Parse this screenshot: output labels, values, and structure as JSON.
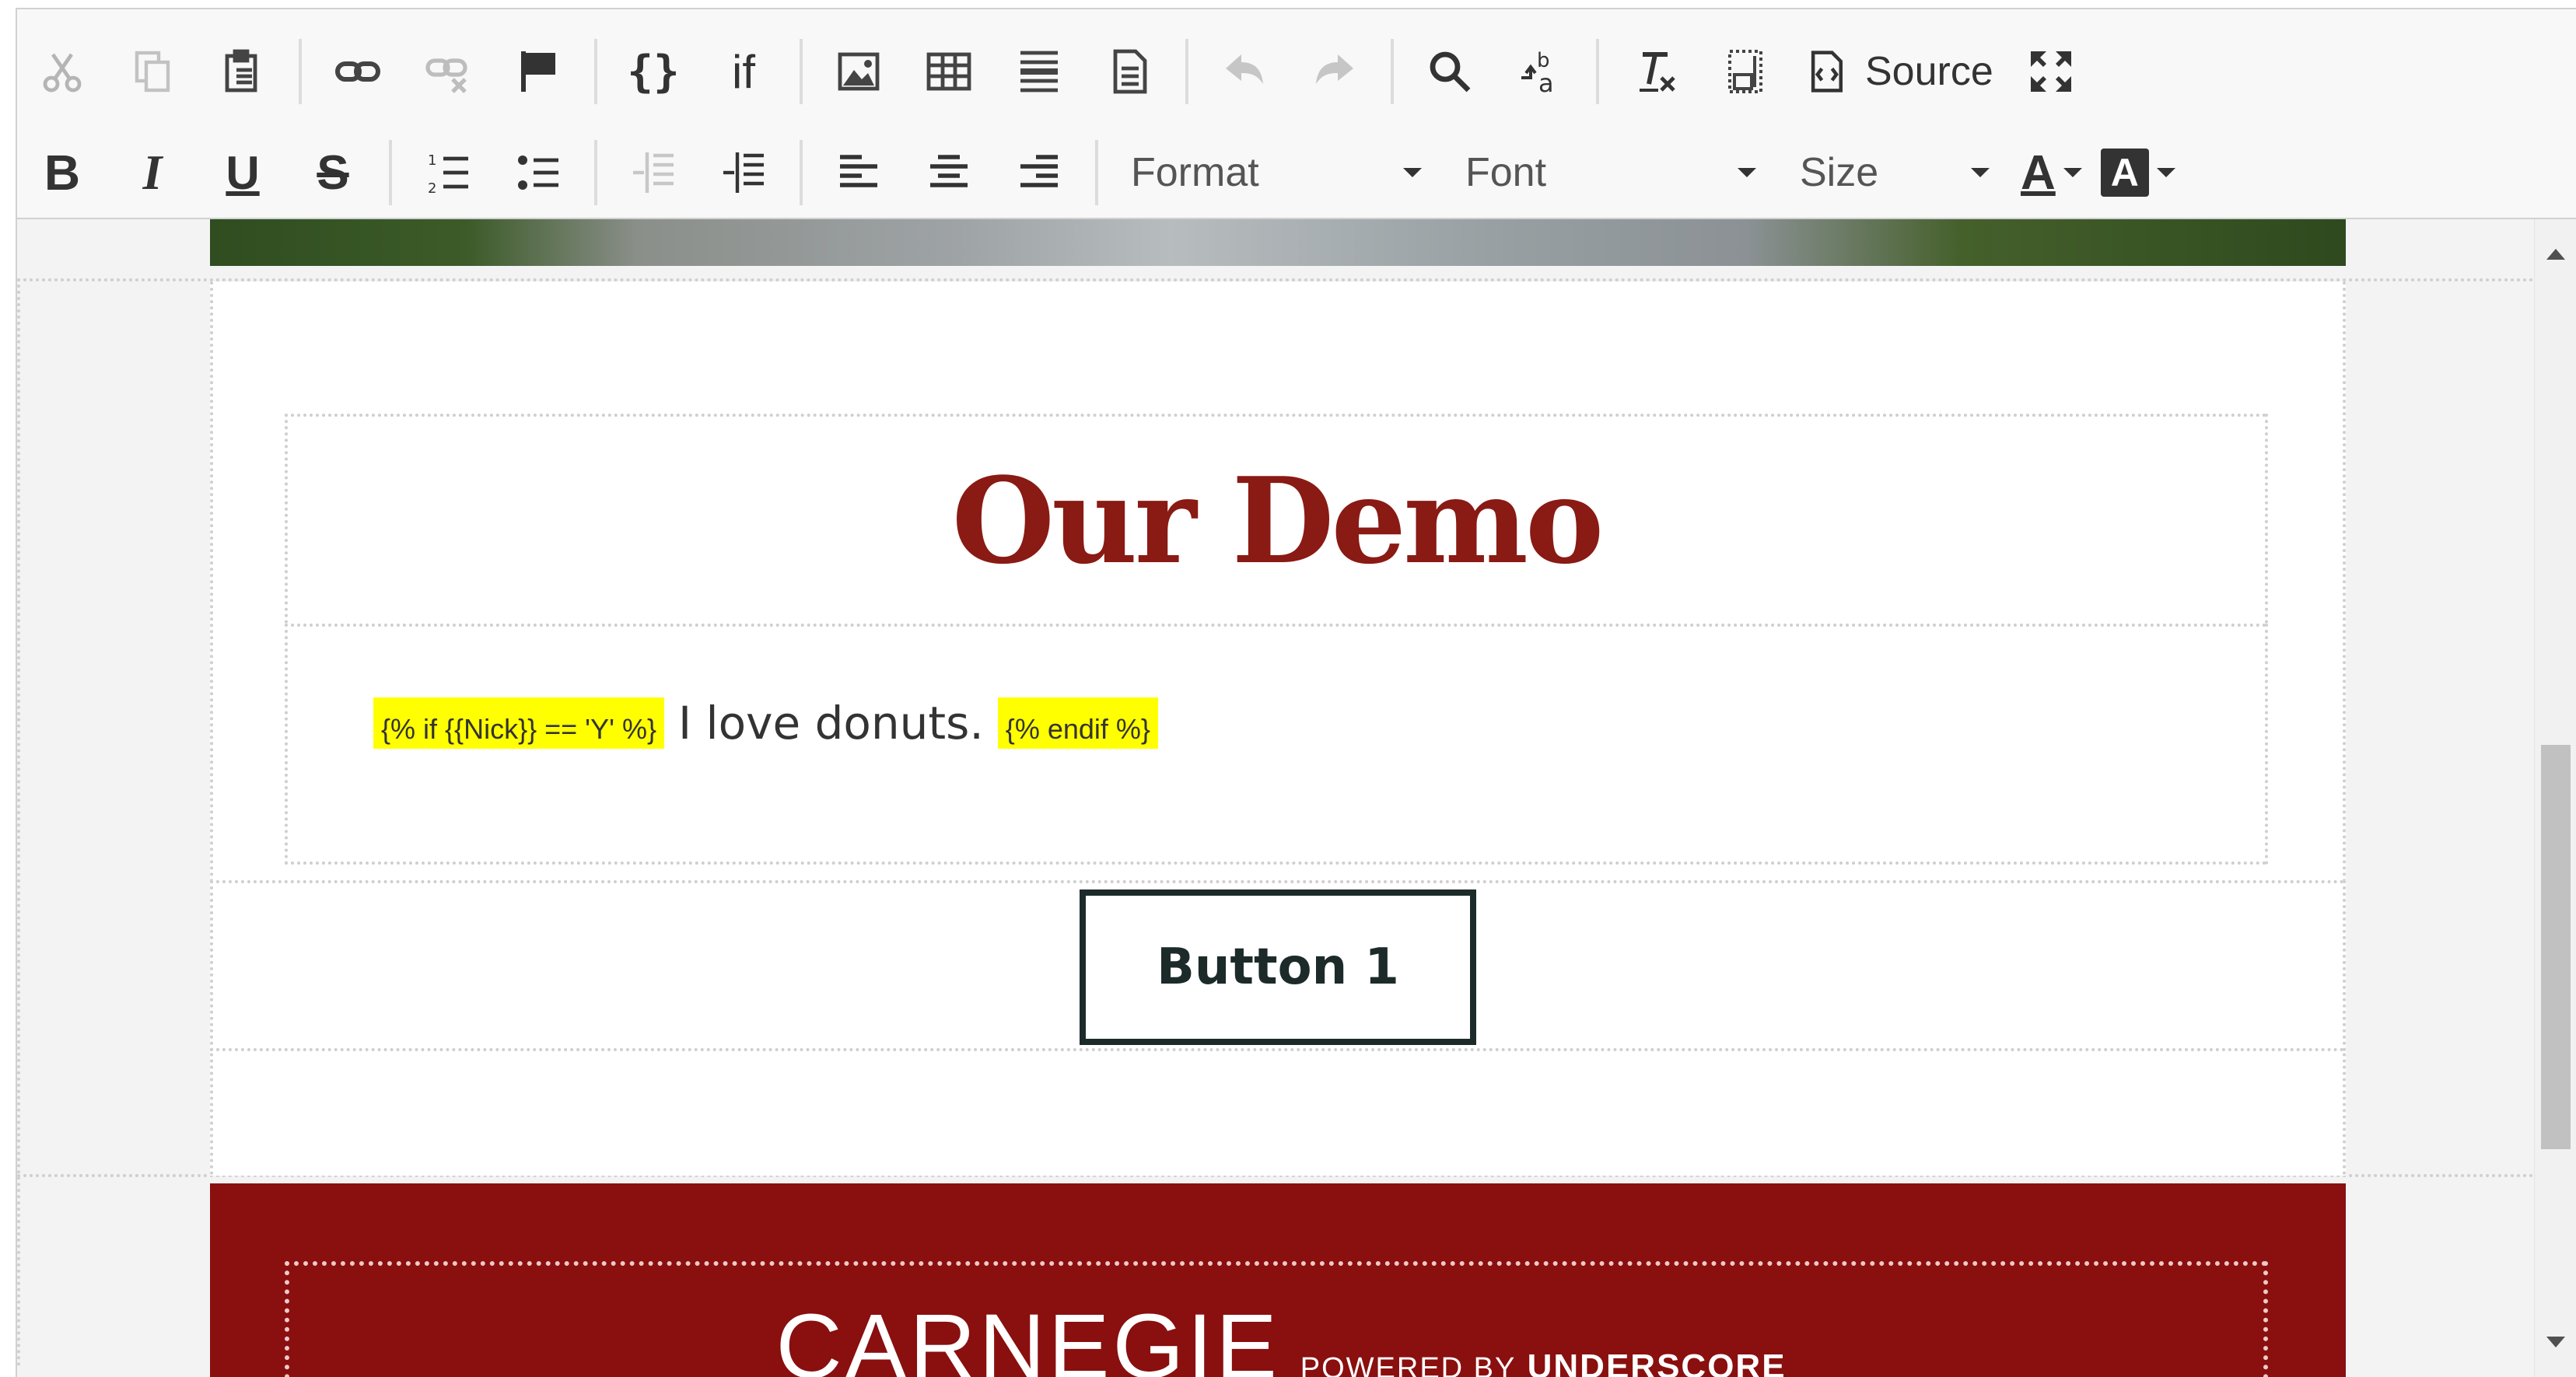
{
  "toolbar": {
    "row1": {
      "cut_icon": "scissors-icon",
      "copy_icon": "copy-icon",
      "paste_icon": "clipboard-icon",
      "link_icon": "link-icon",
      "unlink_icon": "unlink-icon",
      "anchor_icon": "flag-icon",
      "braces_label": "{}",
      "if_label": "if",
      "source_label": "Source"
    },
    "row2": {
      "bold_label": "B",
      "italic_label": "I",
      "underline_label": "U",
      "strike_label": "S",
      "format_label": "Format",
      "font_label": "Font",
      "size_label": "Size",
      "text_color_label": "A",
      "bg_color_label": "A"
    }
  },
  "editor": {
    "title": "Our Demo",
    "tag_open": "{% if {{Nick}} == 'Y' %}",
    "body_text": "I love donuts.",
    "tag_close": "{% endif %}",
    "button_label": "Button 1",
    "footer": {
      "logo_main": "CARNEGIE",
      "logo_powered": "POWERED BY",
      "logo_brand": "UNDERSCORE"
    }
  },
  "colors": {
    "title": "#8a1a14",
    "footer_bg": "#8a0f0f",
    "tag_highlight": "#ffff00",
    "button_border": "#1d2a2a"
  }
}
